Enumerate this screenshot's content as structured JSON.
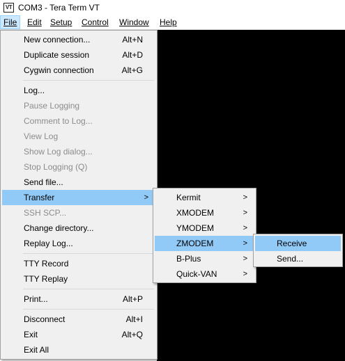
{
  "window": {
    "title": "COM3 - Tera Term VT",
    "icon_text": "VT"
  },
  "menubar": {
    "items": [
      {
        "label": "File",
        "active": true
      },
      {
        "label": "Edit"
      },
      {
        "label": "Setup"
      },
      {
        "label": "Control"
      },
      {
        "label": "Window"
      },
      {
        "label": "Help"
      }
    ]
  },
  "file_menu": {
    "items": [
      {
        "label": "New connection...",
        "accel": "Alt+N",
        "enabled": true
      },
      {
        "label": "Duplicate session",
        "accel": "Alt+D",
        "enabled": true
      },
      {
        "label": "Cygwin connection",
        "accel": "Alt+G",
        "enabled": true
      },
      {
        "label": "Log...",
        "enabled": true
      },
      {
        "label": "Pause Logging",
        "enabled": false
      },
      {
        "label": "Comment to Log...",
        "enabled": false
      },
      {
        "label": "View Log",
        "enabled": false
      },
      {
        "label": "Show Log dialog...",
        "enabled": false
      },
      {
        "label": "Stop Logging (Q)",
        "enabled": false
      },
      {
        "label": "Send file...",
        "enabled": true
      },
      {
        "label": "Transfer",
        "enabled": true,
        "submenu": true,
        "highlighted": true
      },
      {
        "label": "SSH SCP...",
        "enabled": false
      },
      {
        "label": "Change directory...",
        "enabled": true
      },
      {
        "label": "Replay Log...",
        "enabled": true
      },
      {
        "label": "TTY Record",
        "enabled": true
      },
      {
        "label": "TTY Replay",
        "enabled": true
      },
      {
        "label": "Print...",
        "accel": "Alt+P",
        "enabled": true
      },
      {
        "label": "Disconnect",
        "accel": "Alt+I",
        "enabled": true
      },
      {
        "label": "Exit",
        "accel": "Alt+Q",
        "enabled": true
      },
      {
        "label": "Exit All",
        "enabled": true
      }
    ],
    "submenu_arrow": ">"
  },
  "transfer_menu": {
    "items": [
      {
        "label": "Kermit"
      },
      {
        "label": "XMODEM"
      },
      {
        "label": "YMODEM"
      },
      {
        "label": "ZMODEM",
        "highlighted": true
      },
      {
        "label": "B-Plus"
      },
      {
        "label": "Quick-VAN"
      }
    ]
  },
  "zmodem_menu": {
    "items": [
      {
        "label": "Receive",
        "highlighted": true
      },
      {
        "label": "Send..."
      }
    ]
  },
  "colors": {
    "terminal_bg": "#000000",
    "menu_bg": "#f0f0f0",
    "highlight": "#91c9f7",
    "disabled_text": "#8c8c8c"
  }
}
